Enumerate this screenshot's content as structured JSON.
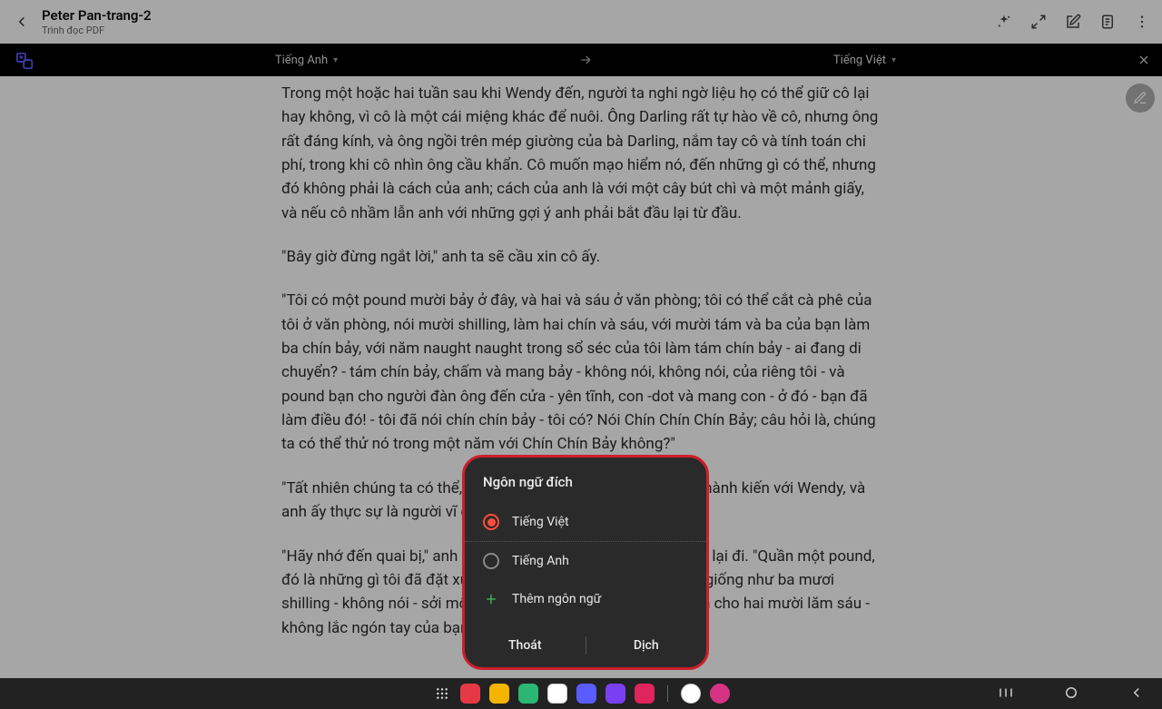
{
  "header": {
    "title": "Peter Pan-trang-2",
    "subtitle": "Trình đọc PDF"
  },
  "langbar": {
    "source": "Tiếng Anh",
    "target": "Tiếng Việt"
  },
  "document": {
    "p1": "Trong một hoặc hai tuần sau khi Wendy đến, người ta nghi ngờ liệu họ có thể giữ cô lại hay không, vì cô là một cái miệng khác để nuôi. Ông Darling rất tự hào về cô, nhưng ông rất đáng kính, và ông ngồi trên mép giường của bà Darling, nắm tay cô và tính toán chi phí, trong khi cô nhìn ông cầu khẩn. Cô muốn mạo hiểm nó, đến những gì có thể, nhưng đó không phải là cách của anh; cách của anh là với một cây bút chì và một mảnh giấy, và nếu cô nhầm lẫn anh với những gợi ý anh phải bắt đầu lại từ đầu.",
    "p2": "\"Bây giờ đừng ngắt lời,\" anh ta sẽ cầu xin cô ấy.",
    "p3": "\"Tôi có một pound mười bảy ở đây, và hai và sáu ở văn phòng; tôi có thể cắt cà phê của tôi ở văn phòng, nói mười shilling, làm hai chín và sáu, với mười tám và ba của bạn làm ba chín bảy, với năm naught naught trong sổ séc của tôi làm tám chín bảy - ai đang di chuyển? - tám chín bảy, chấm và mang bảy - không nói, không nói, của riêng tôi - và pound bạn cho người đàn ông đến cửa - yên tĩnh, con -dot và mang con - ở đó - bạn đã làm điều đó! - tôi đã nói chín chín bảy - tôi có? Nói Chín Chín Chín Bảy; câu hỏi là, chúng ta có thể thử nó trong một năm với Chín Chín Bảy không?\"",
    "p4": "\"Tất nhiên chúng ta có thể, George,\" cô khóc. Nhưng cô ấy có thành kiến với Wendy, và anh ấy thực sự là người vĩ đại hơn trong hai người.",
    "p5": "\"Hãy nhớ đến quai bị,\" anh cảnh báo cô gần như đe dọa, và anh lại đi. \"Quần một pound, đó là những gì tôi đã đặt xuống, nhưng tôi dám nói rằng nó sẽ giống như ba mươi shilling - không nói - sởi một năm, sởi Đức nửa một guinea, làm cho hai mười lăm sáu - không lắc ngón tay của bạn - ho gà, nói mười lăm"
  },
  "dialog": {
    "title": "Ngôn ngữ đích",
    "options": {
      "vietnamese": "Tiếng Việt",
      "english": "Tiếng Anh",
      "add": "Thêm ngôn ngữ"
    },
    "buttons": {
      "cancel": "Thoát",
      "confirm": "Dịch"
    },
    "selected": "vietnamese"
  },
  "taskbar": {
    "apps": [
      {
        "name": "app-red",
        "color": "#e63946"
      },
      {
        "name": "app-files",
        "color": "#f4b400"
      },
      {
        "name": "app-phone",
        "color": "#2bb673"
      },
      {
        "name": "app-chat",
        "color": "#ffffff"
      },
      {
        "name": "app-browser",
        "color": "#5a5cff"
      },
      {
        "name": "app-purple",
        "color": "#7b3ff2"
      },
      {
        "name": "app-camera",
        "color": "#e0245e"
      },
      {
        "name": "app-circle",
        "color": "#ffffff"
      },
      {
        "name": "app-pink",
        "color": "#d63384"
      }
    ]
  }
}
